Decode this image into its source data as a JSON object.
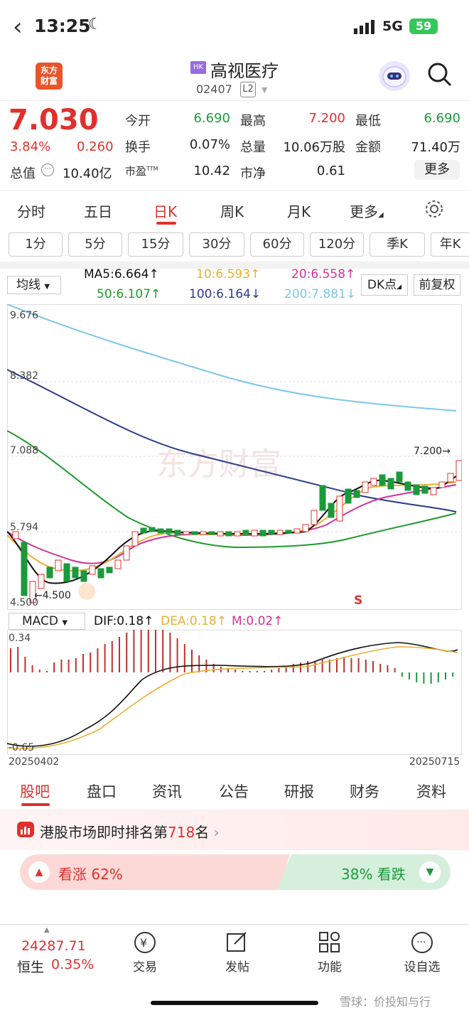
{
  "status": {
    "time": "13:25",
    "network": "5G",
    "battery": "59"
  },
  "header": {
    "logo_text": "东方\n财富",
    "market_badge": "HK",
    "stock_name": "高视医疗",
    "stock_code": "02407",
    "level": "L2"
  },
  "quote": {
    "price": "7.030",
    "change_pct": "3.84%",
    "change": "0.260",
    "open_label": "今开",
    "open": "6.690",
    "high_label": "最高",
    "high": "7.200",
    "low_label": "最低",
    "low": "6.690",
    "turnover_label": "换手",
    "turnover": "0.07%",
    "volume_label": "总量",
    "volume": "10.06万股",
    "amount_label": "金额",
    "amount": "71.40万",
    "mktcap_label": "总值",
    "mktcap": "10.40亿",
    "pe_label": "市盈",
    "pe_sup": "TTM",
    "pe": "10.42",
    "pb_label": "市净",
    "pb": "0.61",
    "more": "更多"
  },
  "period_tabs": [
    "分时",
    "五日",
    "日K",
    "周K",
    "月K",
    "更多"
  ],
  "interval_buttons": [
    "1分",
    "5分",
    "15分",
    "30分",
    "60分",
    "120分",
    "季K",
    "年K"
  ],
  "ma_legend": {
    "select": "均线",
    "ma5": "MA5:6.664↑",
    "ma10": "10:6.593↑",
    "ma20": "20:6.558↑",
    "ma50": "50:6.107↑",
    "ma100": "100:6.164↓",
    "ma200": "200:7.881↓",
    "dk": "DK点",
    "fq": "前复权"
  },
  "colors": {
    "ma5": "#111111",
    "ma10": "#e8b030",
    "ma20": "#d4309a",
    "ma50": "#1f9a2a",
    "ma100": "#2c3a8a",
    "ma200": "#7cc7e8",
    "up": "#e0302d",
    "down": "#1a9a3a"
  },
  "chart_data": {
    "type": "candlestick",
    "y_ticks": [
      "9.676",
      "8.382",
      "7.088",
      "5.794",
      "4.500"
    ],
    "high_label": "7.200→",
    "low_label": "←4.500",
    "signal": "S",
    "watermark": "东方财富",
    "macd": {
      "select": "MACD",
      "dif": "DIF:0.18↑",
      "dea": "DEA:0.18↑",
      "m": "M:0.02↑",
      "y_top": "0.34",
      "y_bottom": "-0.65"
    },
    "x_start": "20250402",
    "x_end": "20250715"
  },
  "info_tabs": [
    "股吧",
    "盘口",
    "资讯",
    "公告",
    "研报",
    "财务",
    "资料"
  ],
  "rank": {
    "text_prefix": "港股市场即时排名第",
    "rank": "718",
    "text_suffix": "名"
  },
  "vote": {
    "bull": "看涨 62%",
    "bear": "38% 看跌"
  },
  "bottom": {
    "index_value": "24287.71",
    "index_name": "恒生",
    "index_pct": "0.35%",
    "items": [
      "交易",
      "发帖",
      "功能",
      "设自选"
    ],
    "watermark": "雪球：价投知与行"
  }
}
